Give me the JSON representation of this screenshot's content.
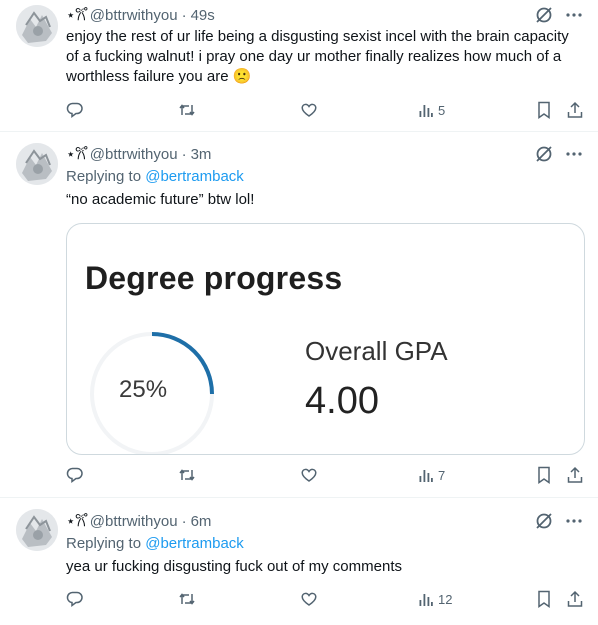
{
  "tweets": [
    {
      "display_name": "⋆𐙚̊",
      "handle": "@bttrwithyou",
      "time": "49s",
      "text": "enjoy the rest of ur life being a disgusting sexist incel with the brain capacity of a fucking walnut! i pray one day ur mother finally realizes how much of a worthless failure you are 🙁",
      "views": "5"
    },
    {
      "display_name": "⋆𐙚̊",
      "handle": "@bttrwithyou",
      "time": "3m",
      "replying_prefix": "Replying to",
      "replying_handle": "@bertramback",
      "text": "“no academic future” btw lol!",
      "views": "7",
      "card": {
        "title": "Degree progress",
        "progress_text": "25%",
        "progress": 0.25,
        "gpa_label": "Overall GPA",
        "gpa_value": "4.00"
      }
    },
    {
      "display_name": "⋆𐙚̊",
      "handle": "@bttrwithyou",
      "time": "6m",
      "replying_prefix": "Replying to",
      "replying_handle": "@bertramback",
      "text": "yea ur fucking disgusting fuck out of my comments",
      "views": "12"
    }
  ],
  "colors": {
    "accent": "#1d9bf0",
    "muted": "#536471",
    "gauge": "#1e6fa8"
  },
  "icons": [
    "grok-icon",
    "more-icon",
    "reply-icon",
    "retweet-icon",
    "like-icon",
    "views-icon",
    "bookmark-icon",
    "share-icon"
  ]
}
